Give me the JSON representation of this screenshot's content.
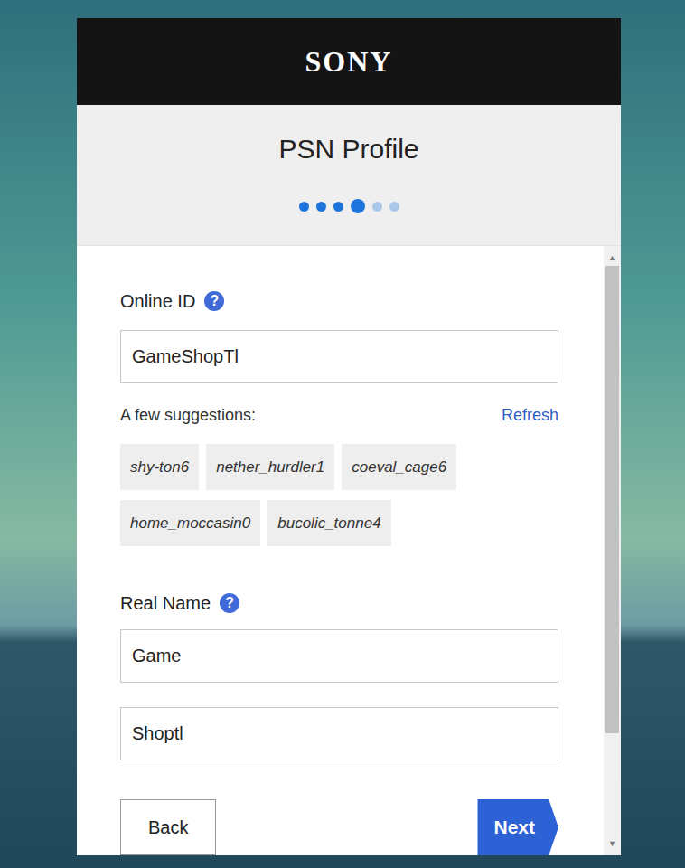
{
  "brand": {
    "logo": "SONY"
  },
  "header": {
    "title": "PSN Profile"
  },
  "steps": [
    {
      "done": true,
      "current": false
    },
    {
      "done": true,
      "current": false
    },
    {
      "done": true,
      "current": false
    },
    {
      "done": true,
      "current": true
    },
    {
      "done": false,
      "current": false
    },
    {
      "done": false,
      "current": false
    }
  ],
  "help_icon": "?",
  "online_id": {
    "label": "Online ID",
    "value": "GameShopTl"
  },
  "suggestions": {
    "label": "A few suggestions:",
    "refresh": "Refresh",
    "items": [
      "shy-ton6",
      "nether_hurdler1",
      "coeval_cage6",
      "home_moccasin0",
      "bucolic_tonne4"
    ]
  },
  "real_name": {
    "label": "Real Name",
    "first": "Game",
    "last": "Shoptl"
  },
  "buttons": {
    "back": "Back",
    "next": "Next"
  },
  "scrollbar": {
    "up": "▲",
    "down": "▼",
    "level": 0.82
  }
}
